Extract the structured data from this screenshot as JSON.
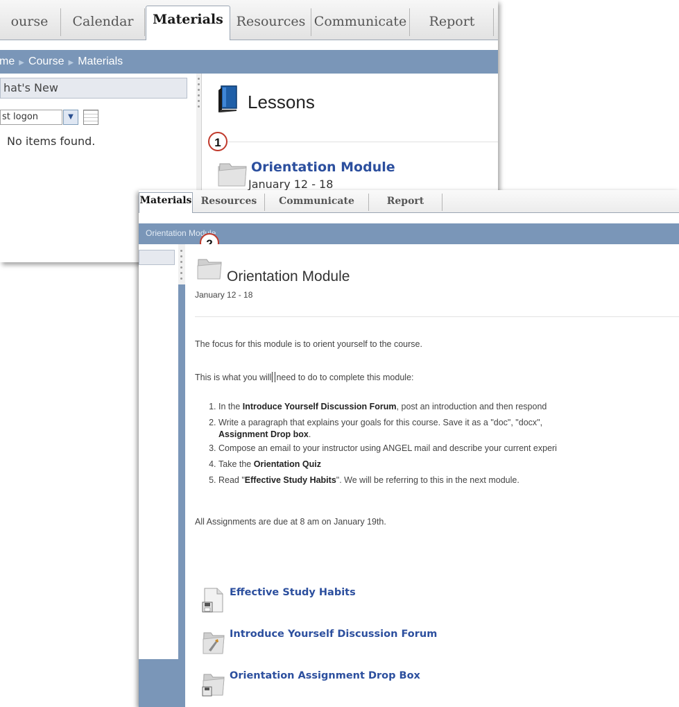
{
  "back_window": {
    "tabs": [
      {
        "label": "ourse",
        "active": false
      },
      {
        "label": "Calendar",
        "active": false
      },
      {
        "label": "Materials",
        "active": true
      },
      {
        "label": "Resources",
        "active": false
      },
      {
        "label": "Communicate",
        "active": false
      },
      {
        "label": "Report",
        "active": false
      }
    ],
    "breadcrumb": [
      "me",
      "Course",
      "Materials"
    ],
    "whats_new": {
      "title": "hat's New",
      "filter_value": "st logon",
      "empty_text": "No items found."
    },
    "lessons_title": "Lessons",
    "module": {
      "title": "Orientation Module",
      "dates": "January 12 - 18"
    }
  },
  "callouts": [
    "1",
    "2"
  ],
  "front_window": {
    "tabs": [
      {
        "label": "Materials",
        "active": true
      },
      {
        "label": "Resources",
        "active": false
      },
      {
        "label": "Communicate",
        "active": false
      },
      {
        "label": "Report",
        "active": false
      }
    ],
    "breadcrumb": "Orientation Module",
    "module_title": "Orientation Module",
    "module_dates": "January 12 - 18",
    "intro": "The focus for this module is to orient yourself to the course.",
    "todo_before_cursor": "This is what you will",
    "todo_after_cursor": "need to do to complete this module:",
    "steps": [
      {
        "pre": "In the ",
        "bold": "Introduce Yourself Discussion Forum",
        "post": ", post an introduction and then respond"
      },
      {
        "pre": "Write a paragraph that explains your goals for this course.  Save it as a \"doc\", \"docx\", ",
        "bold": "",
        "post": ""
      },
      {
        "pre": "Compose an email to your instructor using ANGEL mail and describe your current experi",
        "bold": "",
        "post": ""
      },
      {
        "pre": "Take the ",
        "bold": "Orientation Quiz",
        "post": ""
      },
      {
        "pre": "Read \"",
        "bold": "Effective Study Habits",
        "post": "\".  We will be referring to this in the next module."
      }
    ],
    "step2_continuation": "Assignment Drop box",
    "step2_period": ".",
    "due_note": "All Assignments are due at 8 am on January 19th.",
    "resources": [
      {
        "label": "Effective Study Habits",
        "icon": "document-icon"
      },
      {
        "label": "Introduce Yourself Discussion Forum",
        "icon": "forum-folder-icon"
      },
      {
        "label": "Orientation Assignment Drop Box",
        "icon": "dropbox-folder-icon"
      }
    ]
  },
  "colors": {
    "nav_blue": "#7a96b8",
    "link_blue": "#2c4f9e",
    "callout_red": "#c0392b"
  }
}
